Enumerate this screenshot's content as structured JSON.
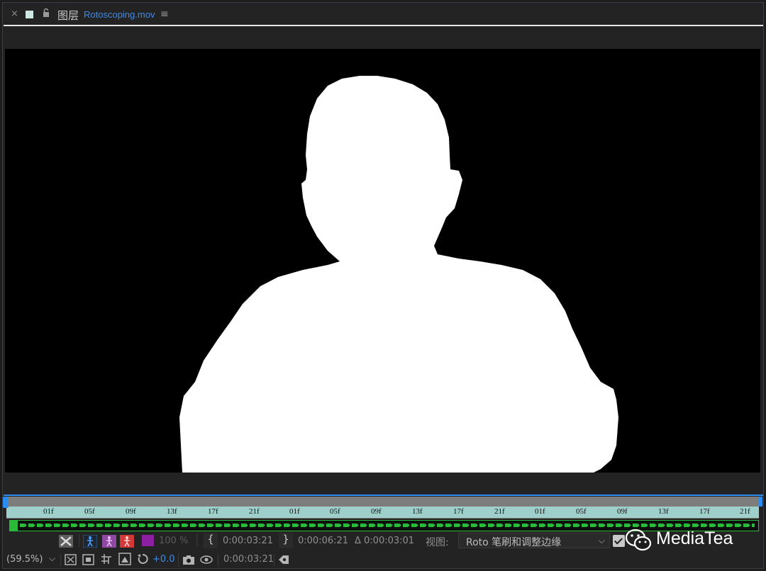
{
  "tab": {
    "close_glyph": "×",
    "panel_title": "图层",
    "filename": "Rotoscoping.mov",
    "menu_glyph": "≡"
  },
  "ruler": {
    "ticks": [
      "01f",
      "05f",
      "09f",
      "13f",
      "17f",
      "21f",
      "01f",
      "05f",
      "09f",
      "13f",
      "17f",
      "21f",
      "01f",
      "05f",
      "09f",
      "13f",
      "17f",
      "21f"
    ]
  },
  "controls": {
    "opacity": "100 %",
    "in_time": "0:00:03:21",
    "out_time": "0:00:06:21",
    "duration": "Δ 0:00:03:01",
    "view_label": "视图:",
    "view_value": "Roto 笔刷和调整边缘",
    "view_chevron": "⌵"
  },
  "bottom": {
    "zoom": "(59.5%)",
    "zoom_chevron": "⌵",
    "exposure": "+0.0",
    "timecode": "0:00:03:21"
  },
  "watermark": {
    "text": "MediaTea"
  },
  "colors": {
    "accent_blue": "#2d8cf0",
    "span_band": "#9fcfca",
    "track_green": "#2bbb3a",
    "matte_white": "#ffffff",
    "canvas_black": "#000000"
  },
  "icons": {
    "view_toggle": "checkerboard-x-icon",
    "roto_brush": "person-brush-icon",
    "refine_edge": "person-refine-icon",
    "erase": "person-red-icon",
    "color_swatch": "magenta-swatch-icon",
    "in_point": "bracket-left-icon",
    "out_point": "bracket-right-icon",
    "snapshot": "camera-icon"
  }
}
